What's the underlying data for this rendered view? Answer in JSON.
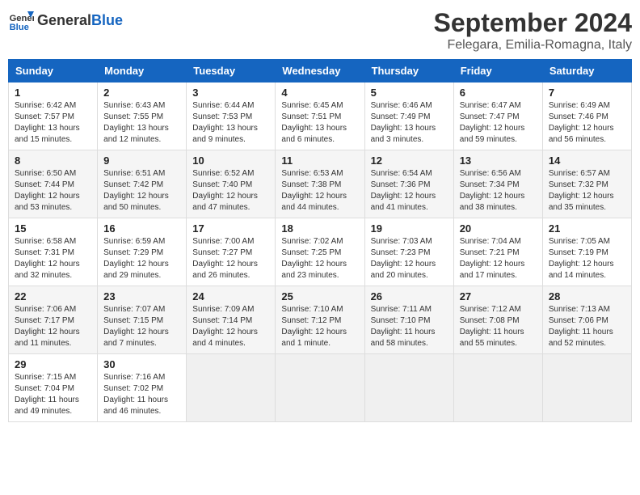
{
  "logo": {
    "text_general": "General",
    "text_blue": "Blue"
  },
  "header": {
    "month": "September 2024",
    "location": "Felegara, Emilia-Romagna, Italy"
  },
  "days_of_week": [
    "Sunday",
    "Monday",
    "Tuesday",
    "Wednesday",
    "Thursday",
    "Friday",
    "Saturday"
  ],
  "weeks": [
    [
      {
        "day": "1",
        "sunrise": "6:42 AM",
        "sunset": "7:57 PM",
        "daylight": "13 hours and 15 minutes."
      },
      {
        "day": "2",
        "sunrise": "6:43 AM",
        "sunset": "7:55 PM",
        "daylight": "13 hours and 12 minutes."
      },
      {
        "day": "3",
        "sunrise": "6:44 AM",
        "sunset": "7:53 PM",
        "daylight": "13 hours and 9 minutes."
      },
      {
        "day": "4",
        "sunrise": "6:45 AM",
        "sunset": "7:51 PM",
        "daylight": "13 hours and 6 minutes."
      },
      {
        "day": "5",
        "sunrise": "6:46 AM",
        "sunset": "7:49 PM",
        "daylight": "13 hours and 3 minutes."
      },
      {
        "day": "6",
        "sunrise": "6:47 AM",
        "sunset": "7:47 PM",
        "daylight": "12 hours and 59 minutes."
      },
      {
        "day": "7",
        "sunrise": "6:49 AM",
        "sunset": "7:46 PM",
        "daylight": "12 hours and 56 minutes."
      }
    ],
    [
      {
        "day": "8",
        "sunrise": "6:50 AM",
        "sunset": "7:44 PM",
        "daylight": "12 hours and 53 minutes."
      },
      {
        "day": "9",
        "sunrise": "6:51 AM",
        "sunset": "7:42 PM",
        "daylight": "12 hours and 50 minutes."
      },
      {
        "day": "10",
        "sunrise": "6:52 AM",
        "sunset": "7:40 PM",
        "daylight": "12 hours and 47 minutes."
      },
      {
        "day": "11",
        "sunrise": "6:53 AM",
        "sunset": "7:38 PM",
        "daylight": "12 hours and 44 minutes."
      },
      {
        "day": "12",
        "sunrise": "6:54 AM",
        "sunset": "7:36 PM",
        "daylight": "12 hours and 41 minutes."
      },
      {
        "day": "13",
        "sunrise": "6:56 AM",
        "sunset": "7:34 PM",
        "daylight": "12 hours and 38 minutes."
      },
      {
        "day": "14",
        "sunrise": "6:57 AM",
        "sunset": "7:32 PM",
        "daylight": "12 hours and 35 minutes."
      }
    ],
    [
      {
        "day": "15",
        "sunrise": "6:58 AM",
        "sunset": "7:31 PM",
        "daylight": "12 hours and 32 minutes."
      },
      {
        "day": "16",
        "sunrise": "6:59 AM",
        "sunset": "7:29 PM",
        "daylight": "12 hours and 29 minutes."
      },
      {
        "day": "17",
        "sunrise": "7:00 AM",
        "sunset": "7:27 PM",
        "daylight": "12 hours and 26 minutes."
      },
      {
        "day": "18",
        "sunrise": "7:02 AM",
        "sunset": "7:25 PM",
        "daylight": "12 hours and 23 minutes."
      },
      {
        "day": "19",
        "sunrise": "7:03 AM",
        "sunset": "7:23 PM",
        "daylight": "12 hours and 20 minutes."
      },
      {
        "day": "20",
        "sunrise": "7:04 AM",
        "sunset": "7:21 PM",
        "daylight": "12 hours and 17 minutes."
      },
      {
        "day": "21",
        "sunrise": "7:05 AM",
        "sunset": "7:19 PM",
        "daylight": "12 hours and 14 minutes."
      }
    ],
    [
      {
        "day": "22",
        "sunrise": "7:06 AM",
        "sunset": "7:17 PM",
        "daylight": "12 hours and 11 minutes."
      },
      {
        "day": "23",
        "sunrise": "7:07 AM",
        "sunset": "7:15 PM",
        "daylight": "12 hours and 7 minutes."
      },
      {
        "day": "24",
        "sunrise": "7:09 AM",
        "sunset": "7:14 PM",
        "daylight": "12 hours and 4 minutes."
      },
      {
        "day": "25",
        "sunrise": "7:10 AM",
        "sunset": "7:12 PM",
        "daylight": "12 hours and 1 minute."
      },
      {
        "day": "26",
        "sunrise": "7:11 AM",
        "sunset": "7:10 PM",
        "daylight": "11 hours and 58 minutes."
      },
      {
        "day": "27",
        "sunrise": "7:12 AM",
        "sunset": "7:08 PM",
        "daylight": "11 hours and 55 minutes."
      },
      {
        "day": "28",
        "sunrise": "7:13 AM",
        "sunset": "7:06 PM",
        "daylight": "11 hours and 52 minutes."
      }
    ],
    [
      {
        "day": "29",
        "sunrise": "7:15 AM",
        "sunset": "7:04 PM",
        "daylight": "11 hours and 49 minutes."
      },
      {
        "day": "30",
        "sunrise": "7:16 AM",
        "sunset": "7:02 PM",
        "daylight": "11 hours and 46 minutes."
      },
      null,
      null,
      null,
      null,
      null
    ]
  ],
  "labels": {
    "sunrise": "Sunrise:",
    "sunset": "Sunset:",
    "daylight": "Daylight:"
  }
}
